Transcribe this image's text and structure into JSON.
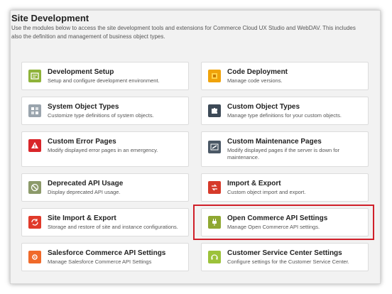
{
  "header": {
    "title": "Site Development",
    "description": "Use the modules below to access the site development tools and extensions for Commerce Cloud UX Studio and WebDAV. This includes also the definition and management of business object types."
  },
  "tiles": [
    {
      "title": "Development Setup",
      "desc": "Setup and configure development environment.",
      "icon": "development-setup-icon",
      "color": "#8fb33a"
    },
    {
      "title": "Code Deployment",
      "desc": "Manage code versions.",
      "icon": "code-deployment-icon",
      "color": "#f0a30a"
    },
    {
      "title": "System Object Types",
      "desc": "Customize type definitions of system objects.",
      "icon": "system-object-types-icon",
      "color": "#9aa4ad"
    },
    {
      "title": "Custom Object Types",
      "desc": "Manage type definitions for your custom objects.",
      "icon": "custom-object-types-icon",
      "color": "#3d4a57"
    },
    {
      "title": "Custom Error Pages",
      "desc": "Modify displayed error pages in an emergency.",
      "icon": "warning-icon",
      "color": "#d9262a"
    },
    {
      "title": "Custom Maintenance Pages",
      "desc": "Modify displayed pages if the server is down for maintenance.",
      "icon": "maintenance-icon",
      "color": "#4b5866"
    },
    {
      "title": "Deprecated API Usage",
      "desc": "Display deprecated API usage.",
      "icon": "deprecated-api-icon",
      "color": "#8c9a6a"
    },
    {
      "title": "Import & Export",
      "desc": "Custom object import and export.",
      "icon": "import-export-icon",
      "color": "#d63a2a"
    },
    {
      "title": "Site Import & Export",
      "desc": "Storage and restore of site and instance configurations.",
      "icon": "site-import-export-icon",
      "color": "#e03a2a"
    },
    {
      "title": "Open Commerce API Settings",
      "desc": "Manage Open Commerce API settings.",
      "icon": "plug-icon",
      "color": "#8fa832"
    },
    {
      "title": "Salesforce Commerce API Settings",
      "desc": "Manage Salesforce Commerce API Settings",
      "icon": "salesforce-api-icon",
      "color": "#f06a2a"
    },
    {
      "title": "Customer Service Center Settings",
      "desc": "Configure settings for the Customer Service Center.",
      "icon": "customer-service-icon",
      "color": "#9cc23a"
    }
  ]
}
